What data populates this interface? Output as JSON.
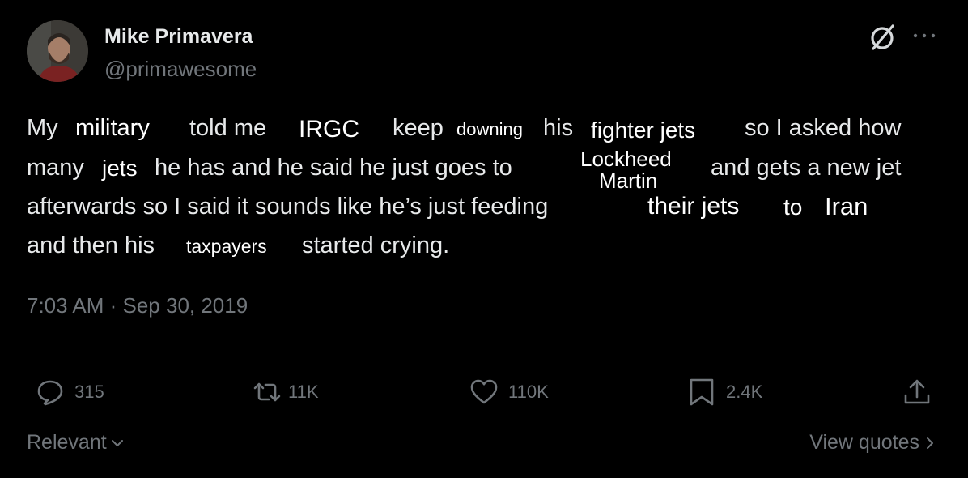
{
  "author": {
    "display_name": "Mike Primavera",
    "handle": "@primawesome"
  },
  "icons": {
    "grok": "grok-icon",
    "more": "more-icon",
    "reply": "reply-icon",
    "repost": "repost-icon",
    "like": "heart-icon",
    "bookmark": "bookmark-icon",
    "share": "share-icon"
  },
  "tweet": {
    "line1": {
      "a": "My",
      "b": "military",
      "c": "told me",
      "d": "IRGC",
      "e": "keep",
      "f": "downing",
      "g": "his",
      "h": "fighter jets",
      "i": "so I asked how"
    },
    "line2": {
      "a": "many",
      "b": "jets",
      "c": "he has and he said he just goes to",
      "d1": "Lockheed",
      "d2": "Martin",
      "e": "and gets a new jet"
    },
    "line3": {
      "a": "afterwards so I said it sounds like he’s just feeding",
      "b": "their jets",
      "c": "to",
      "d": "Iran"
    },
    "line4": {
      "a": "and then his",
      "b": "taxpayers",
      "c": "started crying."
    }
  },
  "timestamp": "7:03 AM · Sep 30, 2019",
  "actions": {
    "replies": "315",
    "reposts": "11K",
    "likes": "110K",
    "bookmarks": "2.4K"
  },
  "footer": {
    "sort": "Relevant",
    "view_quotes": "View quotes"
  },
  "colors": {
    "background": "#000000",
    "text": "#e7e9ea",
    "muted": "#71767b",
    "divider": "#2f3336"
  }
}
